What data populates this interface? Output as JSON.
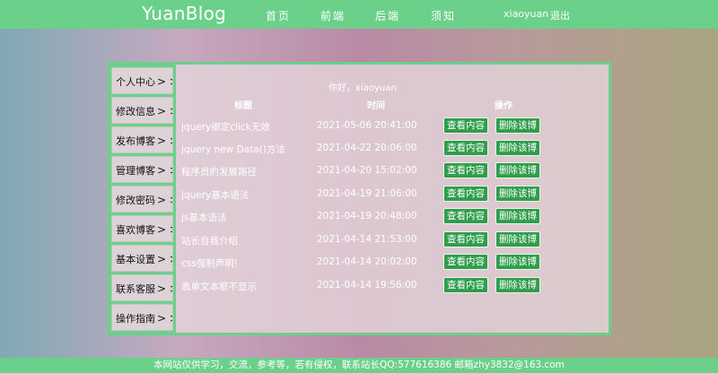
{
  "header": {
    "logo": "YuanBlog",
    "nav": [
      "首页",
      "前端",
      "后端",
      "须知"
    ],
    "user": "xiaoyuan",
    "logout": "退出"
  },
  "sidebar": {
    "arrow": "> >",
    "items": [
      "个人中心",
      "修改信息",
      "发布博客",
      "管理博客",
      "修改密码",
      "喜欢博客",
      "基本设置",
      "联系客服",
      "操作指南"
    ]
  },
  "main": {
    "greeting": "你好，xiaoyuan",
    "columns": [
      "标题",
      "时间",
      "操作"
    ],
    "actions": {
      "view": "查看内容",
      "delete": "删除该博"
    },
    "rows": [
      {
        "title": "jquery绑定click无效",
        "time": "2021-05-06 20:41:00"
      },
      {
        "title": "jquery new Data()方法",
        "time": "2021-04-22 20:06:00"
      },
      {
        "title": "程序员的发展路径",
        "time": "2021-04-20 15:02:00"
      },
      {
        "title": "jquery基本语法",
        "time": "2021-04-19 21:06:00"
      },
      {
        "title": "js基本语法",
        "time": "2021-04-19 20:48:00"
      },
      {
        "title": "站长自我介绍",
        "time": "2021-04-14 21:53:00"
      },
      {
        "title": "css强制声明!",
        "time": "2021-04-14 20:02:00"
      },
      {
        "title": "表单文本框不显示",
        "time": "2021-04-14 19:56:00"
      }
    ]
  },
  "footer": {
    "text": "本网站仅供学习，交流，参考等，若有侵权，联系站长QQ:577616386 邮箱zhy3832@163.com"
  },
  "colors": {
    "accent": "#6bd08a",
    "button": "#2f9d4c"
  }
}
